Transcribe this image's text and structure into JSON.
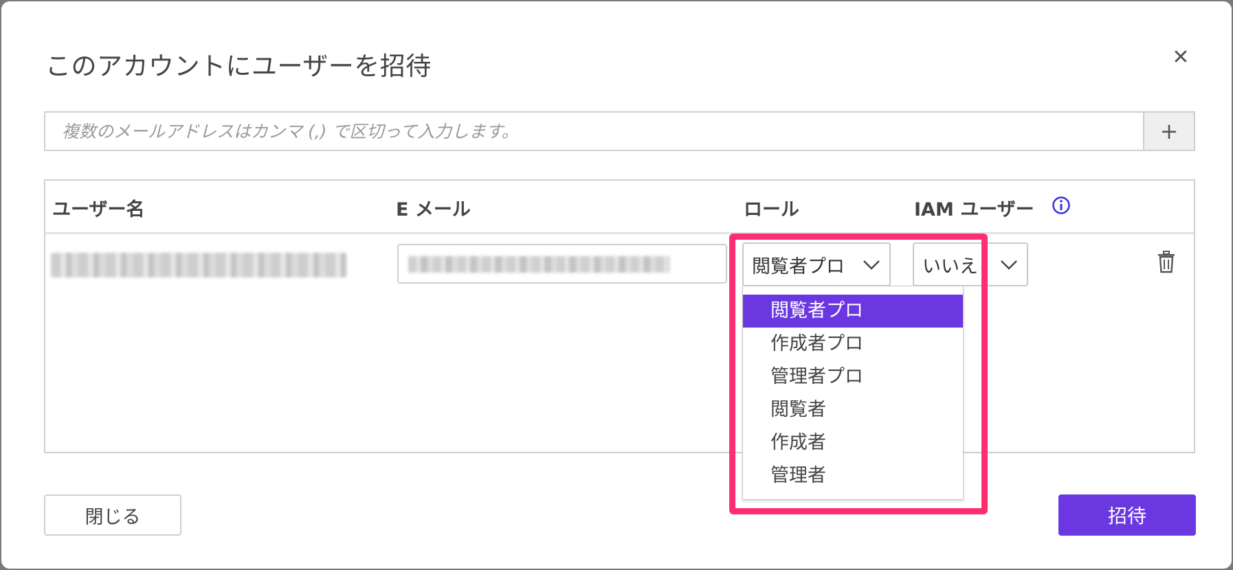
{
  "dialog": {
    "title": "このアカウントにユーザーを招待",
    "close_icon": "close-icon"
  },
  "email_entry": {
    "placeholder": "複数のメールアドレスはカンマ (,) で区切って入力します。",
    "add_label": "+"
  },
  "table": {
    "headers": {
      "username": "ユーザー名",
      "email": "E メール",
      "role": "ロール",
      "iam_user": "IAM ユーザー"
    },
    "info_icon": "info-icon",
    "row": {
      "role_value": "閲覧者プロ",
      "iam_value": "いいえ",
      "delete_icon": "trash-icon"
    }
  },
  "role_dropdown": {
    "options": [
      "閲覧者プロ",
      "作成者プロ",
      "管理者プロ",
      "閲覧者",
      "作成者",
      "管理者"
    ],
    "selected_index": 0
  },
  "footer": {
    "close_label": "閉じる",
    "invite_label": "招待"
  },
  "colors": {
    "accent": "#6a37e0",
    "highlight": "#ff2d6f"
  }
}
